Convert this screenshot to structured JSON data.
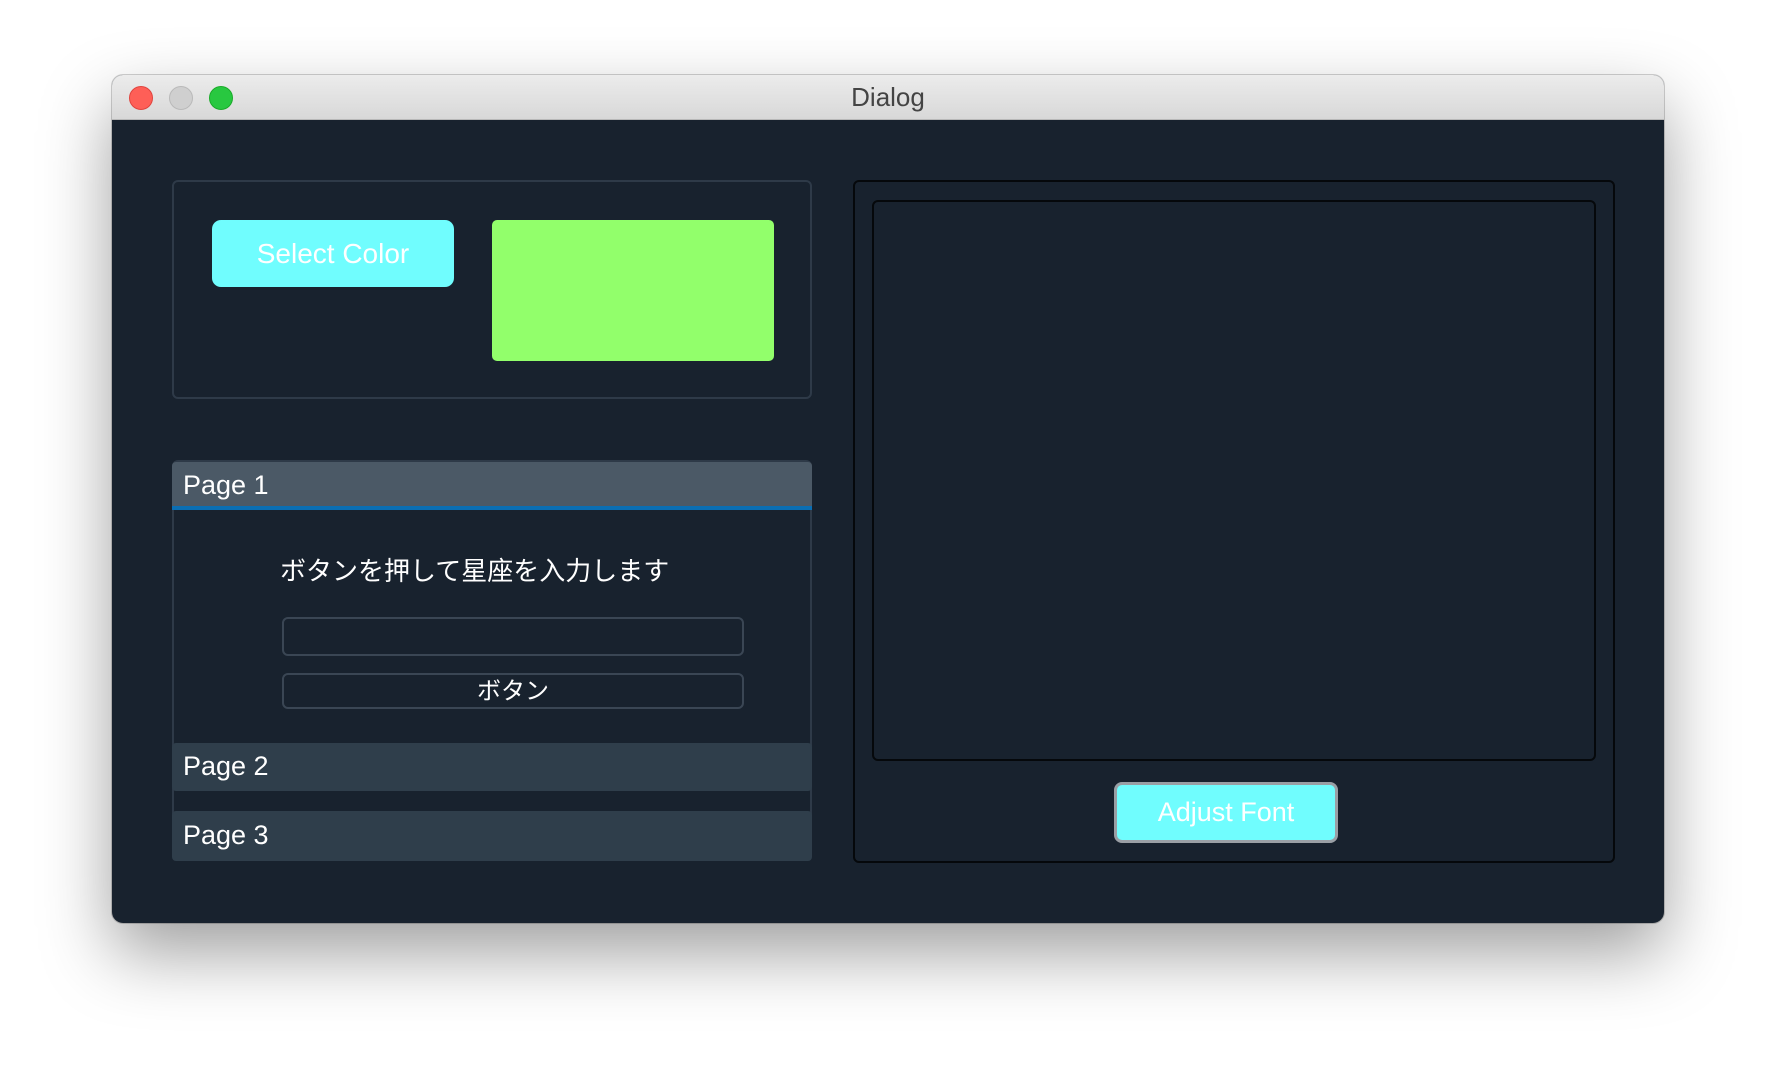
{
  "window": {
    "title": "Dialog"
  },
  "color_panel": {
    "select_color_label": "Select Color",
    "swatch_color": "#92ff6b",
    "button_color": "#70fdfe"
  },
  "toolbox": {
    "pages": [
      {
        "label": "Page 1",
        "active": true
      },
      {
        "label": "Page 2",
        "active": false
      },
      {
        "label": "Page 3",
        "active": false
      }
    ],
    "page1": {
      "instruction": "ボタンを押して星座を入力します",
      "input_value": "",
      "button_label": "ボタン"
    }
  },
  "right_panel": {
    "text_area_value": "",
    "adjust_font_label": "Adjust Font"
  }
}
